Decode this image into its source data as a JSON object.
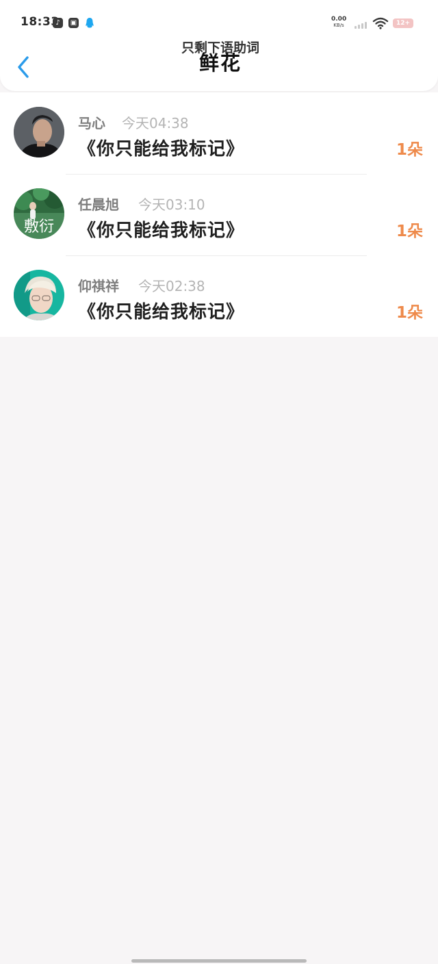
{
  "status_bar": {
    "time": "18:33",
    "net_speed_value": "0.00",
    "net_speed_unit": "KB/s",
    "battery": "12+",
    "icons": [
      "tiktok-icon",
      "gallery-icon",
      "qq-icon",
      "signal-icon",
      "wifi-icon",
      "battery-icon"
    ]
  },
  "header": {
    "subtitle": "只剩下语助词",
    "title": "鲜花",
    "back_icon": "chevron-left-icon"
  },
  "items": [
    {
      "name": "马心",
      "time": "今天04:38",
      "message": "《你只能给我标记》",
      "count": "1朵"
    },
    {
      "name": "任晨旭",
      "time": "今天03:10",
      "message": "《你只能给我标记》",
      "count": "1朵",
      "avatar_text": "敷衍"
    },
    {
      "name": "仰祺祥",
      "time": "今天02:38",
      "message": "《你只能给我标记》",
      "count": "1朵"
    }
  ],
  "colors": {
    "accent": "#2a9bea",
    "count": "#ee8a4b",
    "page_bg": "#f7f5f6"
  }
}
